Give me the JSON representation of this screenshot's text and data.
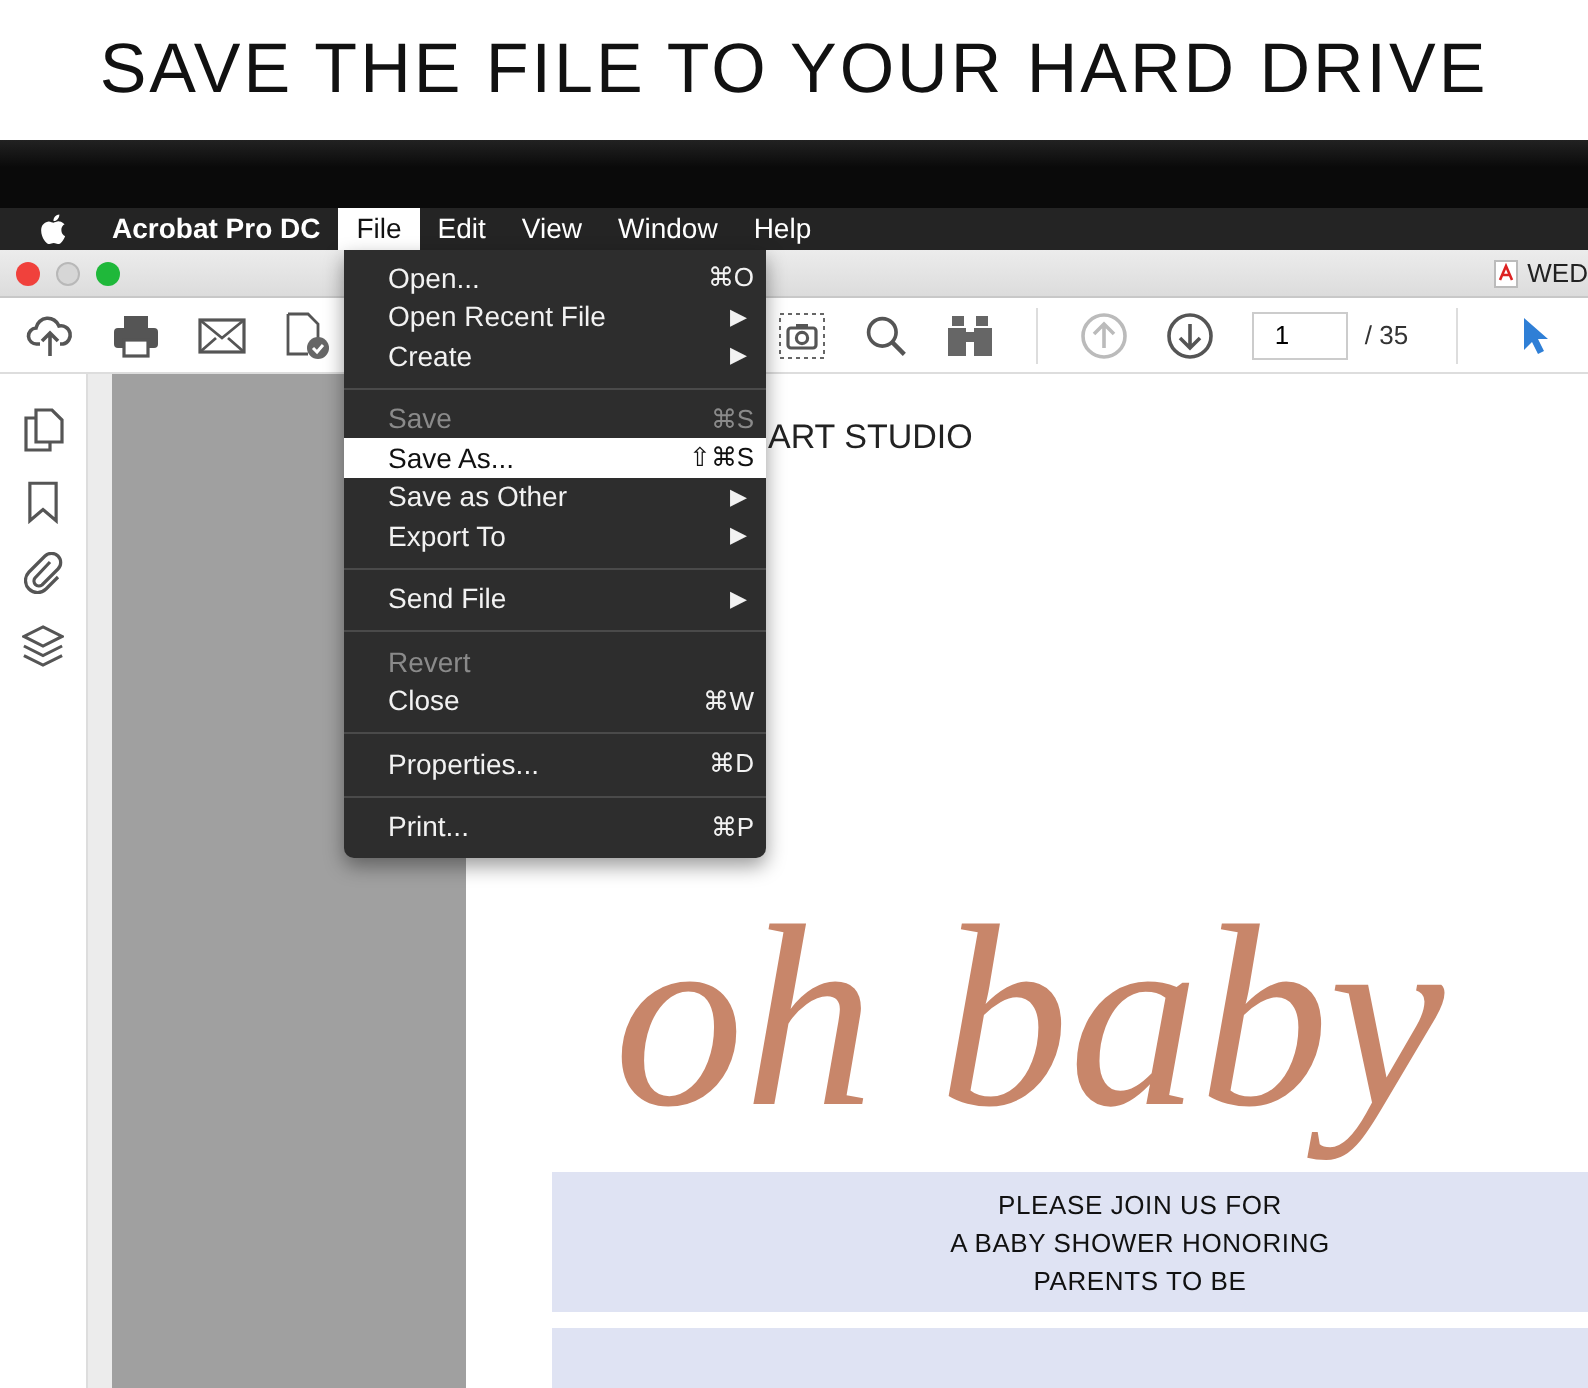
{
  "heading": "SAVE THE FILE TO YOUR HARD DRIVE",
  "menu_bar": {
    "items": [
      {
        "label": "Acrobat Pro DC",
        "kind": "app",
        "selected": false
      },
      {
        "label": "File",
        "kind": "menu",
        "selected": true
      },
      {
        "label": "Edit",
        "kind": "menu",
        "selected": false
      },
      {
        "label": "View",
        "kind": "menu",
        "selected": false
      },
      {
        "label": "Window",
        "kind": "menu",
        "selected": false
      },
      {
        "label": "Help",
        "kind": "menu",
        "selected": false
      }
    ]
  },
  "document_tab": {
    "title": "WED"
  },
  "toolbar": {
    "previous_page_disabled": true,
    "page_field": {
      "value": "1"
    },
    "page_count": "/ 35"
  },
  "file_menu": {
    "groups": [
      [
        {
          "label": "Open...",
          "shortcut": "⌘O",
          "disabled": false,
          "selected": false
        },
        {
          "label": "Open Recent File",
          "arrow": "▶",
          "disabled": false,
          "selected": false
        },
        {
          "label": "Create",
          "arrow": "▶",
          "disabled": false,
          "selected": false
        }
      ],
      [
        {
          "label": "Save",
          "shortcut": "⌘S",
          "disabled": true,
          "selected": false
        },
        {
          "label": "Save As...",
          "shortcut": "⇧⌘S",
          "disabled": false,
          "selected": true
        },
        {
          "label": "Save as Other",
          "arrow": "▶",
          "disabled": false,
          "selected": false
        },
        {
          "label": "Export To",
          "arrow": "▶",
          "disabled": false,
          "selected": false
        }
      ],
      [
        {
          "label": "Send File",
          "arrow": "▶",
          "disabled": false,
          "selected": false
        }
      ],
      [
        {
          "label": "Revert",
          "disabled": true,
          "selected": false
        },
        {
          "label": "Close",
          "shortcut": "⌘W",
          "disabled": false,
          "selected": false
        }
      ],
      [
        {
          "label": "Properties...",
          "shortcut": "⌘D",
          "disabled": false,
          "selected": false
        }
      ],
      [
        {
          "label": "Print...",
          "shortcut": "⌘P",
          "disabled": false,
          "selected": false
        }
      ]
    ]
  },
  "document": {
    "header": "ART STUDIO",
    "script_title": "oh baby",
    "invitation_lines": [
      "PLEASE JOIN US FOR",
      "A BABY SHOWER HONORING",
      "PARENTS TO BE"
    ]
  }
}
